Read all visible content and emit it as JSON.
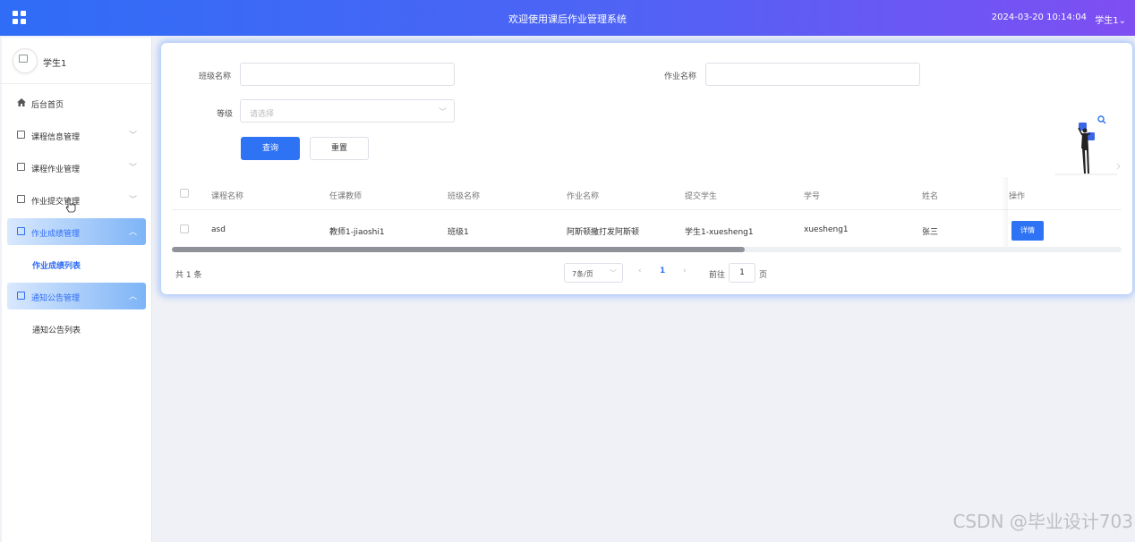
{
  "header": {
    "title": "欢迎使用课后作业管理系统",
    "datetime": "2024-03-20 10:14:04",
    "user": "学生1",
    "user_caret": "⌄"
  },
  "sidebar": {
    "profile_name": "学生1",
    "items": [
      {
        "label": "后台首页"
      },
      {
        "label": "课程信息管理",
        "chevron": "﹀"
      },
      {
        "label": "课程作业管理",
        "chevron": "﹀"
      },
      {
        "label": "作业提交管理",
        "chevron": "﹀"
      },
      {
        "label": "作业成绩管理",
        "chevron": "︿"
      },
      {
        "label": "作业成绩列表"
      },
      {
        "label": "通知公告管理",
        "chevron": "︿"
      },
      {
        "label": "通知公告列表"
      }
    ]
  },
  "filters": {
    "class_label": "班级名称",
    "class_value": "",
    "homework_label": "作业名称",
    "homework_value": "",
    "level_label": "等级",
    "level_placeholder": "请选择",
    "level_caret": "﹀",
    "search_button": "查询",
    "reset_button": "重置"
  },
  "table": {
    "columns": [
      "课程名称",
      "任课教师",
      "班级名称",
      "作业名称",
      "提交学生",
      "学号",
      "姓名",
      "操作"
    ],
    "rows": [
      {
        "course": "asd",
        "teacher": "教师1-jiaoshi1",
        "class": "班级1",
        "homework": "阿斯顿撒打发阿斯顿",
        "student": "学生1-xuesheng1",
        "student_no": "xuesheng1",
        "name": "张三",
        "action": "详情"
      }
    ]
  },
  "pagination": {
    "total": "共 1 条",
    "page_size": "7条/页",
    "page_size_caret": "﹀",
    "prev": "‹",
    "current": "1",
    "next": "›",
    "goto_label": "前往",
    "goto_value": "1",
    "goto_unit": "页"
  },
  "watermark": "CSDN @毕业设计703",
  "colors": {
    "primary": "#2f73f5",
    "header_start": "#2f6df6",
    "header_end": "#7f4ef3"
  }
}
